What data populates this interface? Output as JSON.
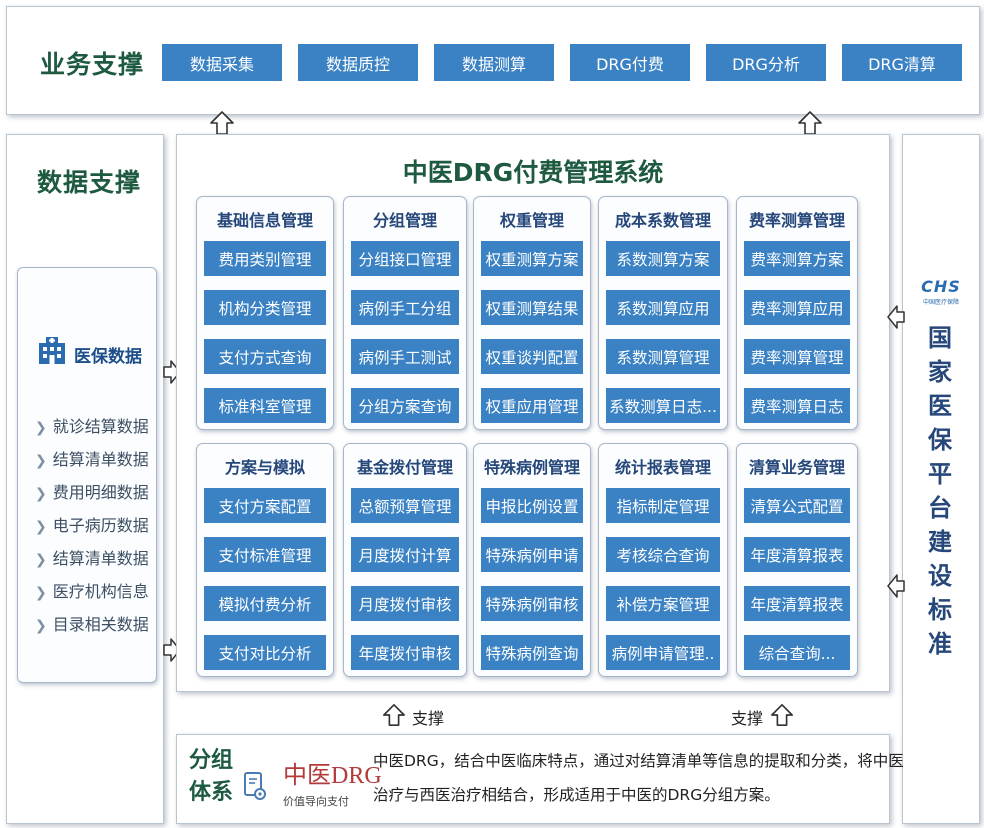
{
  "business": {
    "title": "业务支撑",
    "items": [
      "数据采集",
      "数据质控",
      "数据测算",
      "DRG付费",
      "DRG分析",
      "DRG清算"
    ]
  },
  "data_support": {
    "title": "数据支撑",
    "sub_title": "医保数据",
    "items": [
      "就诊结算数据",
      "结算清单数据",
      "费用明细数据",
      "电子病历数据",
      "结算清单数据",
      "医疗机构信息",
      "目录相关数据"
    ]
  },
  "system": {
    "title": "中医DRG付费管理系统",
    "modules_row1": [
      {
        "title": "基础信息管理",
        "items": [
          "费用类别管理",
          "机构分类管理",
          "支付方式查询",
          "标准科室管理"
        ]
      },
      {
        "title": "分组管理",
        "items": [
          "分组接口管理",
          "病例手工分组",
          "病例手工测试",
          "分组方案查询"
        ]
      },
      {
        "title": "权重管理",
        "items": [
          "权重测算方案",
          "权重测算结果",
          "权重谈判配置",
          "权重应用管理"
        ]
      },
      {
        "title": "成本系数管理",
        "items": [
          "系数测算方案",
          "系数测算应用",
          "系数测算管理",
          "系数测算日志..."
        ]
      },
      {
        "title": "费率测算管理",
        "items": [
          "费率测算方案",
          "费率测算应用",
          "费率测算管理",
          "费率测算日志"
        ]
      }
    ],
    "modules_row2": [
      {
        "title": "方案与模拟",
        "items": [
          "支付方案配置",
          "支付标准管理",
          "模拟付费分析",
          "支付对比分析"
        ]
      },
      {
        "title": "基金拨付管理",
        "items": [
          "总额预算管理",
          "月度拨付计算",
          "月度拨付审核",
          "年度拨付审核"
        ]
      },
      {
        "title": "特殊病例管理",
        "items": [
          "申报比例设置",
          "特殊病例申请",
          "特殊病例审核",
          "特殊病例查询"
        ]
      },
      {
        "title": "统计报表管理",
        "items": [
          "指标制定管理",
          "考核综合查询",
          "补偿方案管理",
          "病例申请管理.."
        ]
      },
      {
        "title": "清算业务管理",
        "items": [
          "清算公式配置",
          "年度清算报表",
          "年度清算报表",
          "综合查询..."
        ]
      }
    ]
  },
  "national": {
    "logo_text": "CHS",
    "logo_sub": "中国医疗保障",
    "title": "国家医保平台建设标准"
  },
  "support_label": "支撑",
  "grouping": {
    "title_line1": "分组",
    "title_line2": "体系",
    "brand": "中医DRG",
    "brand_sub": "价值导向支付",
    "desc_line1": "中医DRG，结合中医临床特点，通过对结算清单等信息的提取和分类，将中医",
    "desc_line2": "治疗与西医治疗相结合，形成适用于中医的DRG分组方案。"
  },
  "colors": {
    "accent_blue": "#3a82c4",
    "title_green": "#1e5a40",
    "module_title": "#26477a",
    "brand_red": "#b23a3a"
  }
}
